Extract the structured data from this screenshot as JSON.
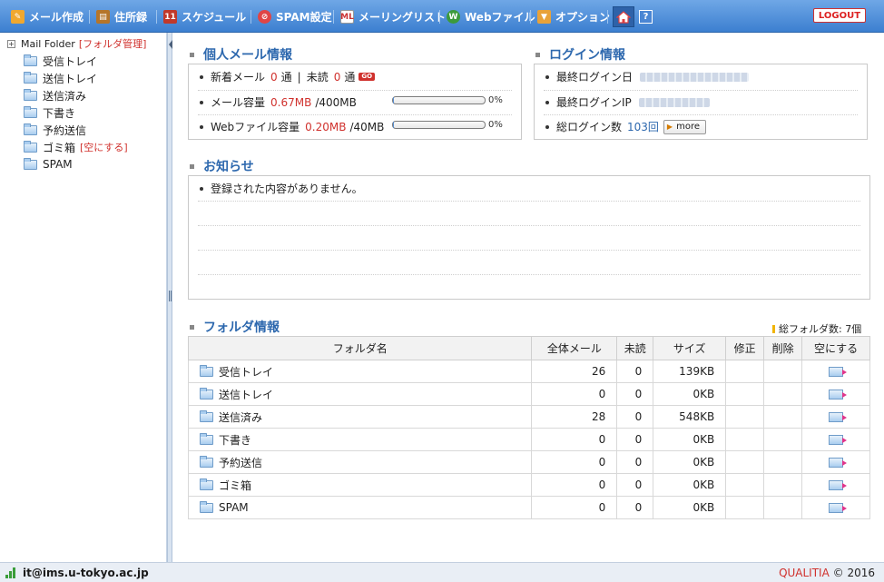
{
  "toolbar": {
    "items": [
      {
        "label": "メール作成",
        "icon": "compose-icon"
      },
      {
        "label": "住所録",
        "icon": "addressbook-icon"
      },
      {
        "label": "スケジュール",
        "icon": "calendar-icon"
      },
      {
        "label": "SPAM設定",
        "icon": "spam-icon"
      },
      {
        "label": "メーリングリスト",
        "icon": "mailinglist-icon"
      },
      {
        "label": "Webファイル",
        "icon": "webfile-icon"
      },
      {
        "label": "オプション",
        "icon": "option-icon"
      }
    ],
    "help_label": "?",
    "logout_label": "LOGOUT",
    "colors": {
      "bar_top": "#6fa7e6",
      "bar_bottom": "#3c7fd0",
      "logout": "#d22222"
    }
  },
  "sidebar": {
    "root_label": "Mail Folder",
    "manage_label": "[フォルダ管理]",
    "folders": [
      {
        "name": "受信トレイ"
      },
      {
        "name": "送信トレイ"
      },
      {
        "name": "送信済み"
      },
      {
        "name": "下書き"
      },
      {
        "name": "予約送信"
      },
      {
        "name": "ゴミ箱",
        "action": "[空にする]"
      },
      {
        "name": "SPAM"
      }
    ]
  },
  "personal": {
    "title": "個人メール情報",
    "new_mail_label": "新着メール",
    "new_mail_count": "0",
    "unit": "通",
    "unread_label": "未読",
    "unread_count": "0",
    "go_label": "GO",
    "mail_capacity_label": "メール容量",
    "mail_used": "0.67MB",
    "mail_total": "/400MB",
    "mail_pct_text": "0%",
    "mail_fill": 0.0017,
    "web_capacity_label": "Webファイル容量",
    "web_used": "0.20MB",
    "web_total": "/40MB",
    "web_pct_text": "0%",
    "web_fill": 0.005
  },
  "login": {
    "title": "ログイン情報",
    "last_login_date_label": "最終ログイン日",
    "last_login_ip_label": "最終ログインIP",
    "total_logins_label": "総ログイン数",
    "total_logins_value": "103回",
    "more_label": "more"
  },
  "notice": {
    "title": "お知らせ",
    "empty_message": "登録された内容がありません。"
  },
  "folder_info": {
    "title": "フォルダ情報",
    "total_label": "総フォルダ数: 7個",
    "columns": [
      "フォルダ名",
      "全体メール",
      "未読",
      "サイズ",
      "修正",
      "削除",
      "空にする"
    ],
    "rows": [
      {
        "name": "受信トレイ",
        "total": "26",
        "unread": "0",
        "size": "139KB"
      },
      {
        "name": "送信トレイ",
        "total": "0",
        "unread": "0",
        "size": "0KB"
      },
      {
        "name": "送信済み",
        "total": "28",
        "unread": "0",
        "size": "548KB"
      },
      {
        "name": "下書き",
        "total": "0",
        "unread": "0",
        "size": "0KB"
      },
      {
        "name": "予約送信",
        "total": "0",
        "unread": "0",
        "size": "0KB"
      },
      {
        "name": "ゴミ箱",
        "total": "0",
        "unread": "0",
        "size": "0KB"
      },
      {
        "name": "SPAM",
        "total": "0",
        "unread": "0",
        "size": "0KB"
      }
    ]
  },
  "footer": {
    "user_email": "it@ims.u-tokyo.ac.jp",
    "brand": "QUALITIA",
    "copyright": "© 2016",
    "brand_color": "#d0312d"
  }
}
